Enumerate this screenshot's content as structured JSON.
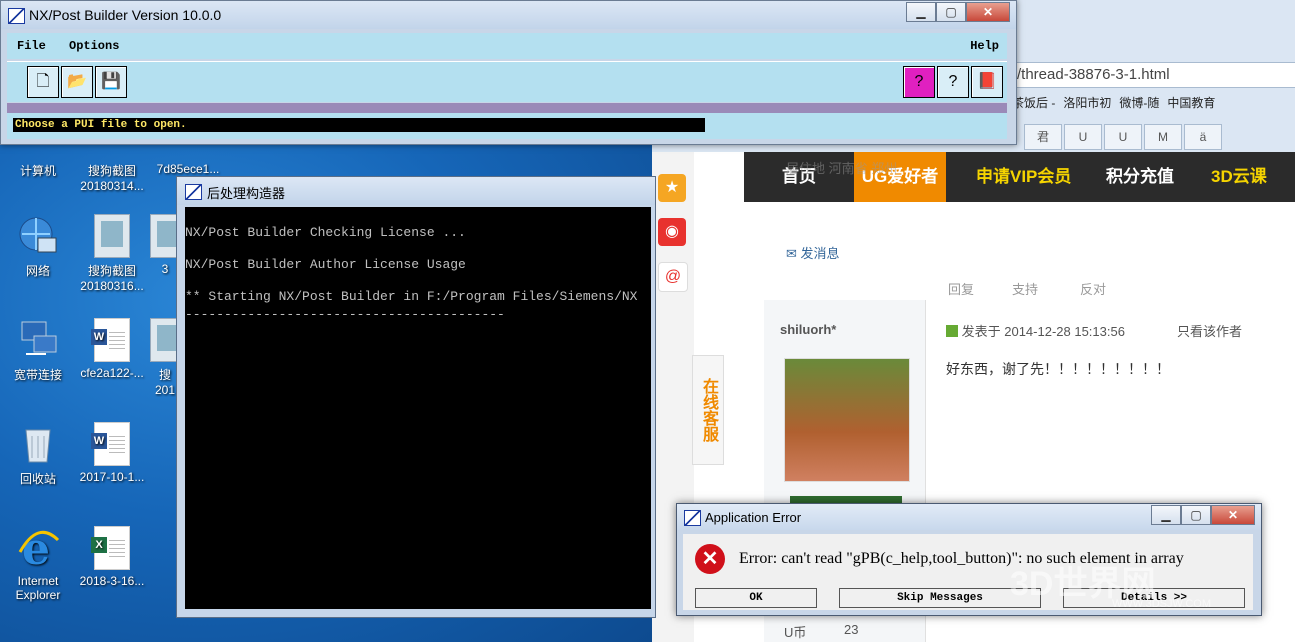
{
  "desktop": {
    "icons": [
      {
        "label": "计算机"
      },
      {
        "label": "搜狗截图\n20180314..."
      },
      {
        "label": "7d85ece1..."
      },
      {
        "label": "网络"
      },
      {
        "label": "搜狗截图\n20180316..."
      },
      {
        "label": "3"
      },
      {
        "label": "宽带连接"
      },
      {
        "label": "cfe2a122-..."
      },
      {
        "label": "搜\n201"
      },
      {
        "label": "回收站"
      },
      {
        "label": "2017-10-1..."
      },
      {
        "label": "Internet\nExplorer"
      },
      {
        "label": "2018-3-16..."
      }
    ]
  },
  "nx_window": {
    "title": "NX/Post Builder Version 10.0.0",
    "menu": {
      "file": "File",
      "options": "Options",
      "help": "Help"
    },
    "status_message": "Choose a PUI file to open.",
    "controls": {
      "minimize": "▁",
      "maximize": "▢",
      "close": "✕"
    }
  },
  "console": {
    "title": "后处理构造器",
    "lines": [
      "NX/Post Builder Checking License ...",
      "NX/Post Builder Author License Usage",
      "** Starting NX/Post Builder in F:/Program Files/Siemens/NX",
      "-----------------------------------------"
    ]
  },
  "browser": {
    "url": "/thread-38876-3-1.html",
    "bookmarks": [
      "茶饭后 -",
      "洛阳市初",
      "微博-随",
      "中国教育"
    ],
    "tabs": [
      "君",
      "U",
      "U",
      "M",
      "ä"
    ],
    "nav": {
      "home": "首页",
      "ug": "UG爱好者",
      "vip": "申请VIP会员",
      "points": "积分充值",
      "cloud": "3D云课"
    },
    "faded_text": "居住地  河南省 郑州",
    "send_message": "发消息",
    "actions": {
      "reply": "回复",
      "support": "支持",
      "oppose": "反对"
    },
    "online_service": "在线客服",
    "post": {
      "author": "shiluorh*",
      "posted": "发表于 2014-12-28 15:13:56",
      "only_author": "只看该作者",
      "body": "好东西，谢了先！！！！！！！！！",
      "ub_label": "U币",
      "ub_value": "23"
    }
  },
  "error_dialog": {
    "title": "Application Error",
    "message": "Error: can't read \"gPB(c_help,tool_button)\": no such element in array",
    "buttons": {
      "ok": "OK",
      "skip": "Skip Messages",
      "details": "Details >>"
    }
  },
  "watermark": {
    "text": "3D世界网",
    "url": "WWW.3DSJW.COM"
  }
}
